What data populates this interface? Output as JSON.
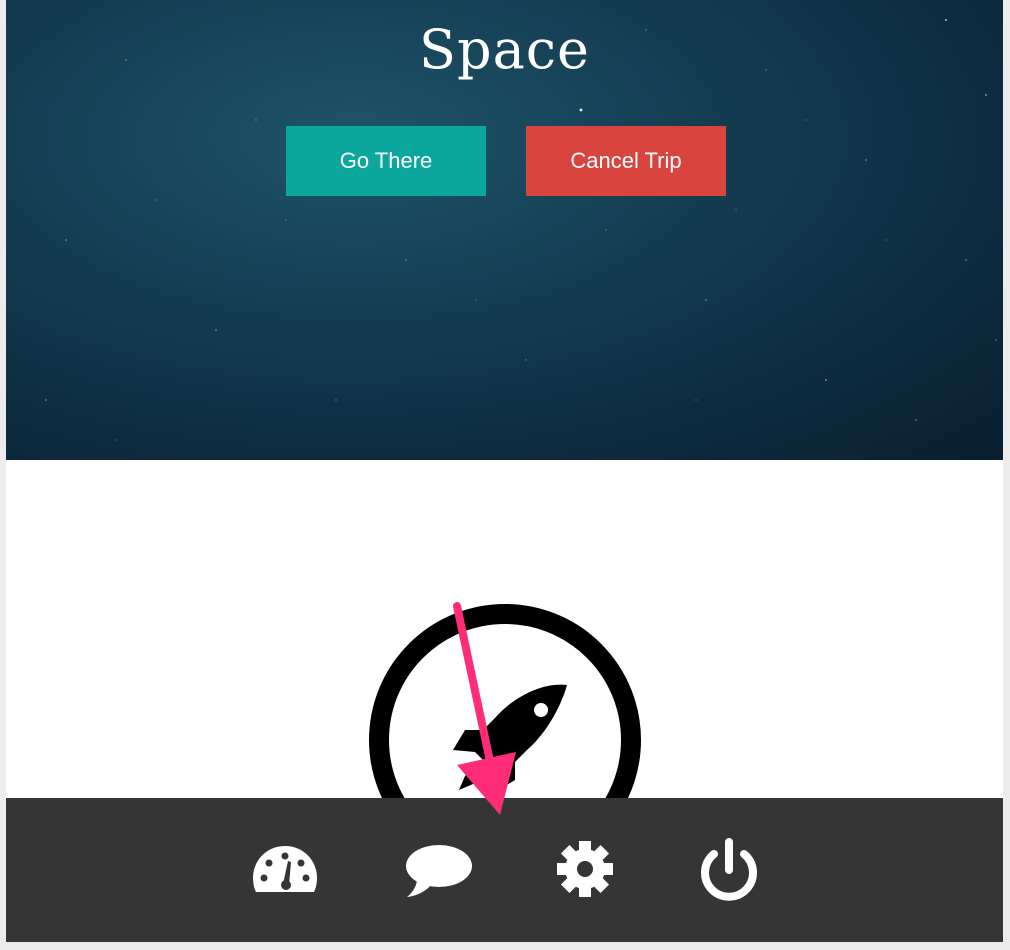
{
  "hero": {
    "title": "Space",
    "buttons": {
      "go_there": "Go There",
      "cancel_trip": "Cancel Trip"
    }
  },
  "colors": {
    "go_button": "#0ca79c",
    "cancel_button": "#d9443f",
    "toolbar_bg": "#353535",
    "annotation_arrow": "#ff2d78"
  },
  "main": {
    "icon": "rocket-icon"
  },
  "toolbar": {
    "items": [
      {
        "icon": "dashboard-icon"
      },
      {
        "icon": "chat-icon"
      },
      {
        "icon": "gear-icon"
      },
      {
        "icon": "power-icon"
      }
    ]
  }
}
